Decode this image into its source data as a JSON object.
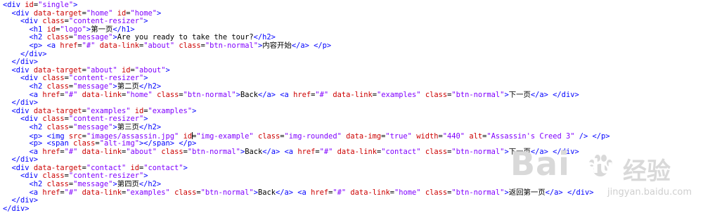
{
  "lines": [
    {
      "html": "<span class=\"t\">&lt;div</span> <span class=\"a\">id</span>=<span class=\"v\">\"single\"</span><span class=\"t\">&gt;</span>"
    },
    {
      "html": "  <span class=\"t\">&lt;div</span> <span class=\"a\">data-target</span>=<span class=\"v\">\"home\"</span> <span class=\"a\">id</span>=<span class=\"v\">\"home\"</span><span class=\"t\">&gt;</span>"
    },
    {
      "html": "    <span class=\"t\">&lt;div</span> <span class=\"a\">class</span>=<span class=\"v\">\"content-resizer\"</span><span class=\"t\">&gt;</span>"
    },
    {
      "html": "      <span class=\"t\">&lt;h1</span> <span class=\"a\">id</span>=<span class=\"v\">\"logo\"</span><span class=\"t\">&gt;</span><span class=\"x\">第一页</span><span class=\"t\">&lt;/h1&gt;</span>"
    },
    {
      "html": "      <span class=\"t\">&lt;h2</span> <span class=\"a\">class</span>=<span class=\"v\">\"message\"</span><span class=\"t\">&gt;</span><span class=\"x\">Are you ready to take the tour?</span><span class=\"t\">&lt;/h2&gt;</span>"
    },
    {
      "html": "      <span class=\"t\">&lt;p&gt;</span> <span class=\"t\">&lt;a</span> <span class=\"a\">href</span>=<span class=\"v\">\"#\"</span> <span class=\"a\">data-link</span>=<span class=\"v\">\"about\"</span> <span class=\"a\">class</span>=<span class=\"v\">\"btn-normal\"</span><span class=\"t\">&gt;</span><span class=\"x\">内容开始</span><span class=\"t\">&lt;/a&gt;</span> <span class=\"t\">&lt;/p&gt;</span>"
    },
    {
      "html": "    <span class=\"t\">&lt;/div&gt;</span>"
    },
    {
      "html": "  <span class=\"t\">&lt;/div&gt;</span>"
    },
    {
      "html": "  <span class=\"t\">&lt;div</span> <span class=\"a\">data-target</span>=<span class=\"v\">\"about\"</span> <span class=\"a\">id</span>=<span class=\"v\">\"about\"</span><span class=\"t\">&gt;</span>"
    },
    {
      "html": "    <span class=\"t\">&lt;div</span> <span class=\"a\">class</span>=<span class=\"v\">\"content-resizer\"</span><span class=\"t\">&gt;</span>"
    },
    {
      "html": "      <span class=\"t\">&lt;h2</span> <span class=\"a\">class</span>=<span class=\"v\">\"message\"</span><span class=\"t\">&gt;</span><span class=\"x\">第二页</span><span class=\"t\">&lt;/h2&gt;</span>"
    },
    {
      "html": "      <span class=\"t\">&lt;a</span> <span class=\"a\">href</span>=<span class=\"v\">\"#\"</span> <span class=\"a\">data-link</span>=<span class=\"v\">\"home\"</span> <span class=\"a\">class</span>=<span class=\"v\">\"btn-normal\"</span><span class=\"t\">&gt;</span><span class=\"x\">Back</span><span class=\"t\">&lt;/a&gt;</span> <span class=\"t\">&lt;a</span> <span class=\"a\">href</span>=<span class=\"v\">\"#\"</span> <span class=\"a\">data-link</span>=<span class=\"v\">\"examples\"</span> <span class=\"a\">class</span>=<span class=\"v\">\"btn-normal\"</span><span class=\"t\">&gt;</span><span class=\"x\">下一页</span><span class=\"t\">&lt;/a&gt;</span> <span class=\"t\">&lt;/div&gt;</span>"
    },
    {
      "html": "  <span class=\"t\">&lt;/div&gt;</span>"
    },
    {
      "html": "  <span class=\"t\">&lt;div</span> <span class=\"a\">data-target</span>=<span class=\"v\">\"examples\"</span> <span class=\"a\">id</span>=<span class=\"v\">\"examples\"</span><span class=\"t\">&gt;</span>"
    },
    {
      "html": "    <span class=\"t\">&lt;div</span> <span class=\"a\">class</span>=<span class=\"v\">\"content-resizer\"</span><span class=\"t\">&gt;</span>"
    },
    {
      "html": "      <span class=\"t\">&lt;h2</span> <span class=\"a\">class</span>=<span class=\"v\">\"message\"</span><span class=\"t\">&gt;</span><span class=\"x\">第三页</span><span class=\"t\">&lt;/h2&gt;</span>"
    },
    {
      "html": "      <span class=\"t\">&lt;p&gt;</span> <span class=\"t\">&lt;img</span> <span class=\"a\">src</span>=<span class=\"v\">\"images/assassin.jpg\"</span> <span class=\"a\">id</span><span class=\"caret\"></span>=<span class=\"v\">\"img-example\"</span> <span class=\"a\">class</span>=<span class=\"v\">\"img-rounded\"</span> <span class=\"a\">data-img</span>=<span class=\"v\">\"true\"</span> <span class=\"a\">width</span>=<span class=\"v\">\"440\"</span> <span class=\"a\">alt</span>=<span class=\"v\">\"Assassin's Creed 3\"</span> <span class=\"t\">/&gt;</span> <span class=\"t\">&lt;/p&gt;</span>"
    },
    {
      "html": "      <span class=\"t\">&lt;p&gt;</span> <span class=\"t\">&lt;span</span> <span class=\"a\">class</span>=<span class=\"v\">\"alt-img\"</span><span class=\"t\">&gt;&lt;/span&gt;</span> <span class=\"t\">&lt;/p&gt;</span>"
    },
    {
      "html": "      <span class=\"t\">&lt;a</span> <span class=\"a\">href</span>=<span class=\"v\">\"#\"</span> <span class=\"a\">data-link</span>=<span class=\"v\">\"about\"</span> <span class=\"a\">class</span>=<span class=\"v\">\"btn-normal\"</span><span class=\"t\">&gt;</span><span class=\"x\">Back</span><span class=\"t\">&lt;/a&gt;</span> <span class=\"t\">&lt;a</span> <span class=\"a\">href</span>=<span class=\"v\">\"#\"</span> <span class=\"a\">data-link</span>=<span class=\"v\">\"contact\"</span> <span class=\"a\">class</span>=<span class=\"v\">\"btn-normal\"</span><span class=\"t\">&gt;</span><span class=\"x\">下一页</span><span class=\"t\">&lt;/a&gt;</span> <span class=\"t\">&lt;/div&gt;</span>"
    },
    {
      "html": "  <span class=\"t\">&lt;/div&gt;</span>"
    },
    {
      "html": "  <span class=\"t\">&lt;div</span> <span class=\"a\">data-target</span>=<span class=\"v\">\"contact\"</span> <span class=\"a\">id</span>=<span class=\"v\">\"contact\"</span><span class=\"t\">&gt;</span>"
    },
    {
      "html": "    <span class=\"t\">&lt;div</span> <span class=\"a\">class</span>=<span class=\"v\">\"content-resizer\"</span><span class=\"t\">&gt;</span>"
    },
    {
      "html": "      <span class=\"t\">&lt;h2</span> <span class=\"a\">class</span>=<span class=\"v\">\"message\"</span><span class=\"t\">&gt;</span><span class=\"x\">第四页</span><span class=\"t\">&lt;/h2&gt;</span>"
    },
    {
      "html": "      <span class=\"t\">&lt;a</span> <span class=\"a\">href</span>=<span class=\"v\">\"#\"</span> <span class=\"a\">data-link</span>=<span class=\"v\">\"examples\"</span> <span class=\"a\">class</span>=<span class=\"v\">\"btn-normal\"</span><span class=\"t\">&gt;</span><span class=\"x\">Back</span><span class=\"t\">&lt;/a&gt;</span> <span class=\"t\">&lt;a</span> <span class=\"a\">href</span>=<span class=\"v\">\"#\"</span> <span class=\"a\">data-link</span>=<span class=\"v\">\"home\"</span> <span class=\"a\">class</span>=<span class=\"v\">\"btn-normal\"</span><span class=\"t\">&gt;</span><span class=\"x\">返回第一页</span><span class=\"t\">&lt;/a&gt;</span> <span class=\"t\">&lt;/div&gt;</span>"
    },
    {
      "html": "  <span class=\"t\">&lt;/div&gt;</span>"
    },
    {
      "html": "<span class=\"t\">&lt;/div&gt;</span>"
    }
  ],
  "watermark": {
    "logo_text": "Bai",
    "logo_text_2": "du",
    "logo_cn": "经验",
    "url": "jingyan.baidu.com"
  },
  "colors": {
    "tag": "#0000ff",
    "attr": "#cc0000",
    "value": "#8000ff",
    "text": "#000000"
  }
}
